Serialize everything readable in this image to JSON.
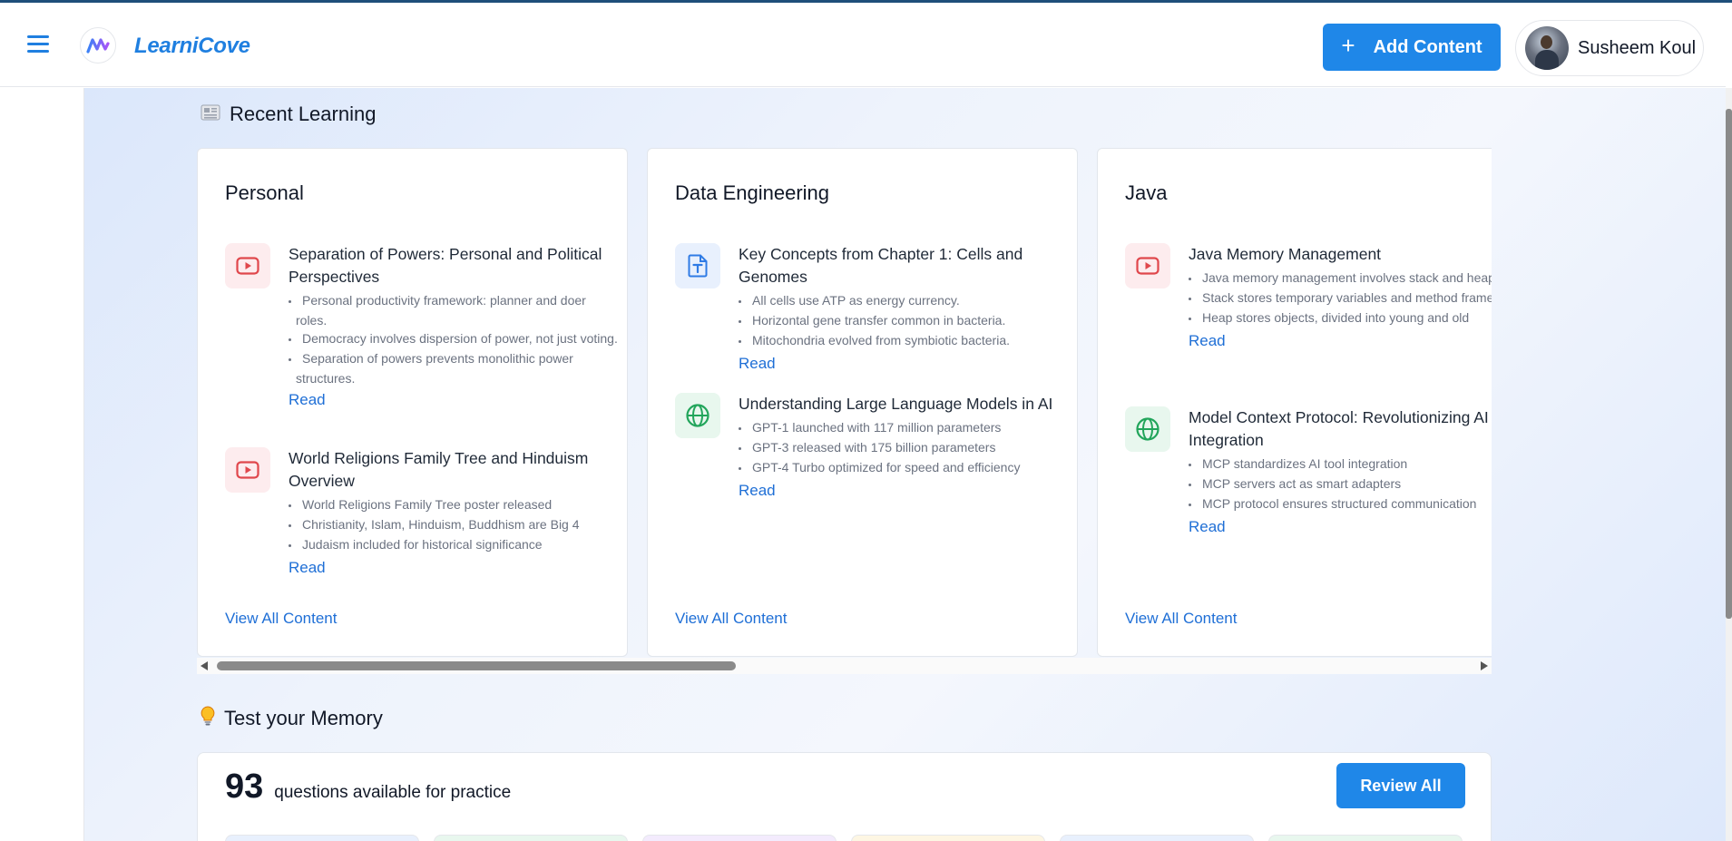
{
  "app": {
    "brand": "LearniCove"
  },
  "header": {
    "add_button_label": "Add Content",
    "user_name": "Susheem Koul"
  },
  "recent": {
    "title": "Recent Learning",
    "view_all_label": "View All Content",
    "read_label": "Read",
    "cards": [
      {
        "title": "Personal",
        "items": [
          {
            "icon": "youtube-icon",
            "title": "Separation of Powers: Personal and Political Perspectives",
            "points": [
              "Personal productivity framework: planner and doer roles.",
              "Democracy involves dispersion of power, not just voting.",
              "Separation of powers prevents monolithic power structures."
            ]
          },
          {
            "icon": "youtube-icon",
            "title": "World Religions Family Tree and Hinduism Overview",
            "points": [
              "World Religions Family Tree poster released",
              "Christianity, Islam, Hinduism, Buddhism are Big 4",
              "Judaism included for historical significance"
            ]
          }
        ]
      },
      {
        "title": "Data Engineering",
        "items": [
          {
            "icon": "document-icon",
            "title": "Key Concepts from Chapter 1: Cells and Genomes",
            "points": [
              "All cells use ATP as energy currency.",
              "Horizontal gene transfer common in bacteria.",
              "Mitochondria evolved from symbiotic bacteria."
            ]
          },
          {
            "icon": "globe-icon",
            "title": "Understanding Large Language Models in AI",
            "points": [
              "GPT-1 launched with 117 million parameters",
              "GPT-3 released with 175 billion parameters",
              "GPT-4 Turbo optimized for speed and efficiency"
            ]
          }
        ]
      },
      {
        "title": "Java",
        "items": [
          {
            "icon": "youtube-icon",
            "title": "Java Memory Management",
            "points": [
              "Java memory management involves stack and heap.",
              "Stack stores temporary variables and method frames.",
              "Heap stores objects, divided into young and old"
            ]
          },
          {
            "icon": "globe-icon",
            "title": "Model Context Protocol: Revolutionizing AI Integration",
            "points": [
              "MCP standardizes AI tool integration",
              "MCP servers act as smart adapters",
              "MCP protocol ensures structured communication"
            ]
          }
        ]
      }
    ]
  },
  "memory": {
    "title": "Test your Memory",
    "count": "93",
    "count_text": "questions available for practice",
    "review_label": "Review All"
  },
  "colors": {
    "accent": "#1f87e8",
    "link": "#1f6fd6",
    "youtube": "#e0474c",
    "document": "#2f7be5",
    "globe": "#22a55b"
  }
}
